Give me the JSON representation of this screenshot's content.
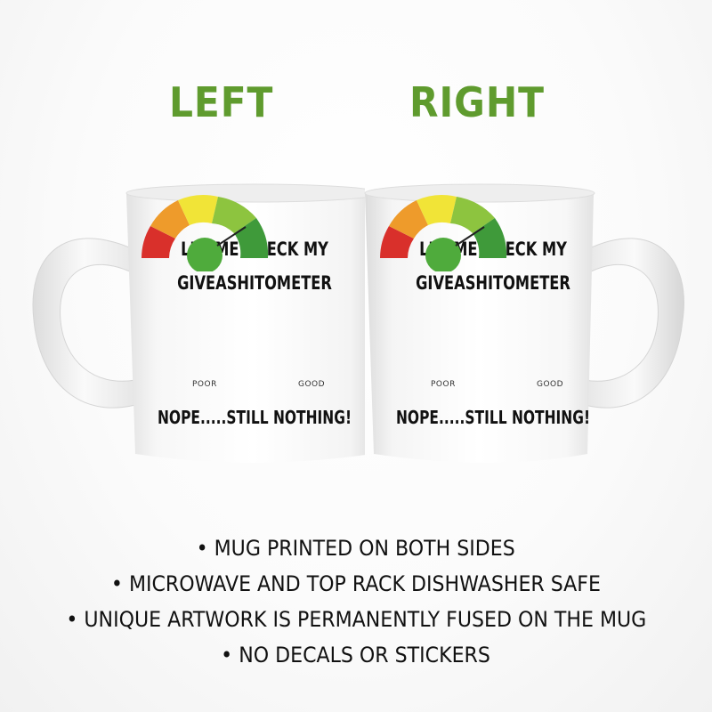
{
  "labels": {
    "left": "LEFT",
    "right": "RIGHT"
  },
  "mug_art": {
    "line1": "LET ME CHECK MY",
    "line2": "GIVEASHITOMETER",
    "gauge_low": "POOR",
    "gauge_high": "GOOD",
    "line3": "NOPE.....STILL NOTHING!"
  },
  "features": [
    "• MUG PRINTED ON BOTH SIDES",
    "• MICROWAVE AND TOP RACK DISHWASHER SAFE",
    "• UNIQUE ARTWORK IS PERMANENTLY FUSED ON THE MUG",
    "• NO DECALS OR STICKERS"
  ],
  "colors": {
    "label_green": "#5f9b2e",
    "gauge_red": "#d9302b",
    "gauge_orange": "#ee9b2b",
    "gauge_yellow": "#f1e437",
    "gauge_lightgreen": "#8dc43f",
    "gauge_green": "#3f9a3a",
    "hub_green": "#4fab3c"
  }
}
